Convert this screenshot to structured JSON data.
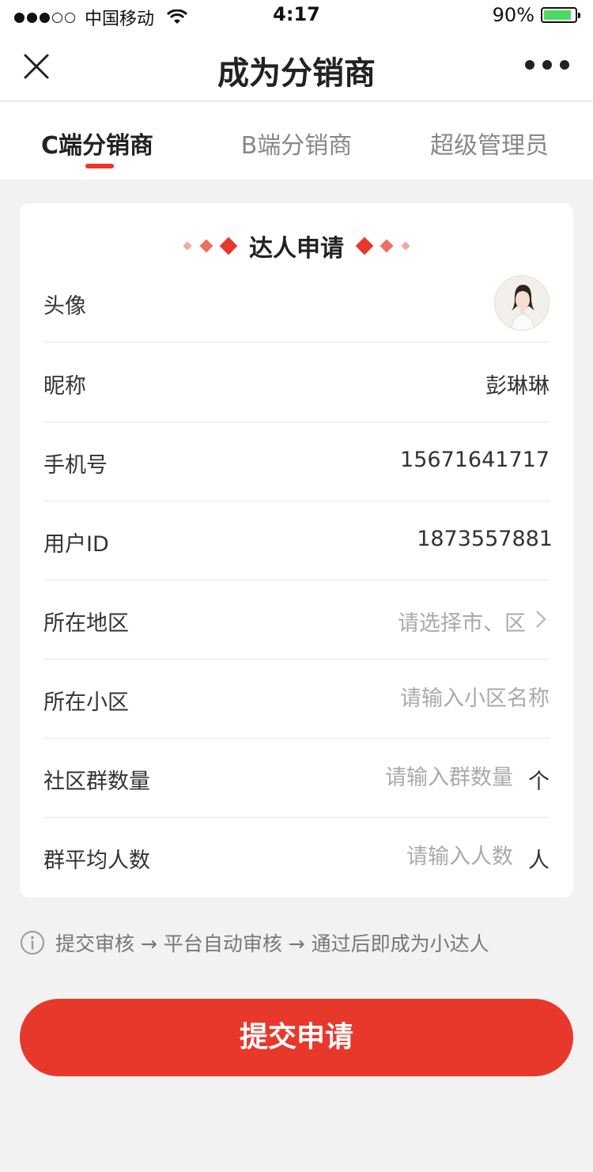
{
  "status_bar": {
    "carrier": "中国移动",
    "time": "4:17",
    "battery": "90%",
    "battery_level": 0.9,
    "battery_color": "#4cd964"
  },
  "nav": {
    "title": "成为分销商",
    "close_icon": "close-icon",
    "more_icon": "more-icon"
  },
  "tabs": [
    {
      "label": "C端分销商",
      "active": true
    },
    {
      "label": "B端分销商",
      "active": false
    },
    {
      "label": "超级管理员",
      "active": false
    }
  ],
  "form": {
    "title": "达人申请",
    "rows": {
      "avatar": {
        "label": "头像"
      },
      "nickname": {
        "label": "昵称",
        "value": "彭琳琳"
      },
      "phone": {
        "label": "手机号",
        "value": "15671641717"
      },
      "user_id": {
        "label": "用户ID",
        "value": "1873557881"
      },
      "region": {
        "label": "所在地区",
        "placeholder": "请选择市、区"
      },
      "community": {
        "label": "所在小区",
        "placeholder": "请输入小区名称"
      },
      "group_count": {
        "label": "社区群数量",
        "placeholder": "请输入群数量",
        "unit": "个"
      },
      "group_avg": {
        "label": "群平均人数",
        "placeholder": "请输入人数",
        "unit": "人"
      }
    }
  },
  "tip": "提交审核 → 平台自动审核 → 通过后即成为小达人",
  "submit_label": "提交申请",
  "colors": {
    "accent": "#e8382b",
    "background": "#f2f2f2"
  }
}
